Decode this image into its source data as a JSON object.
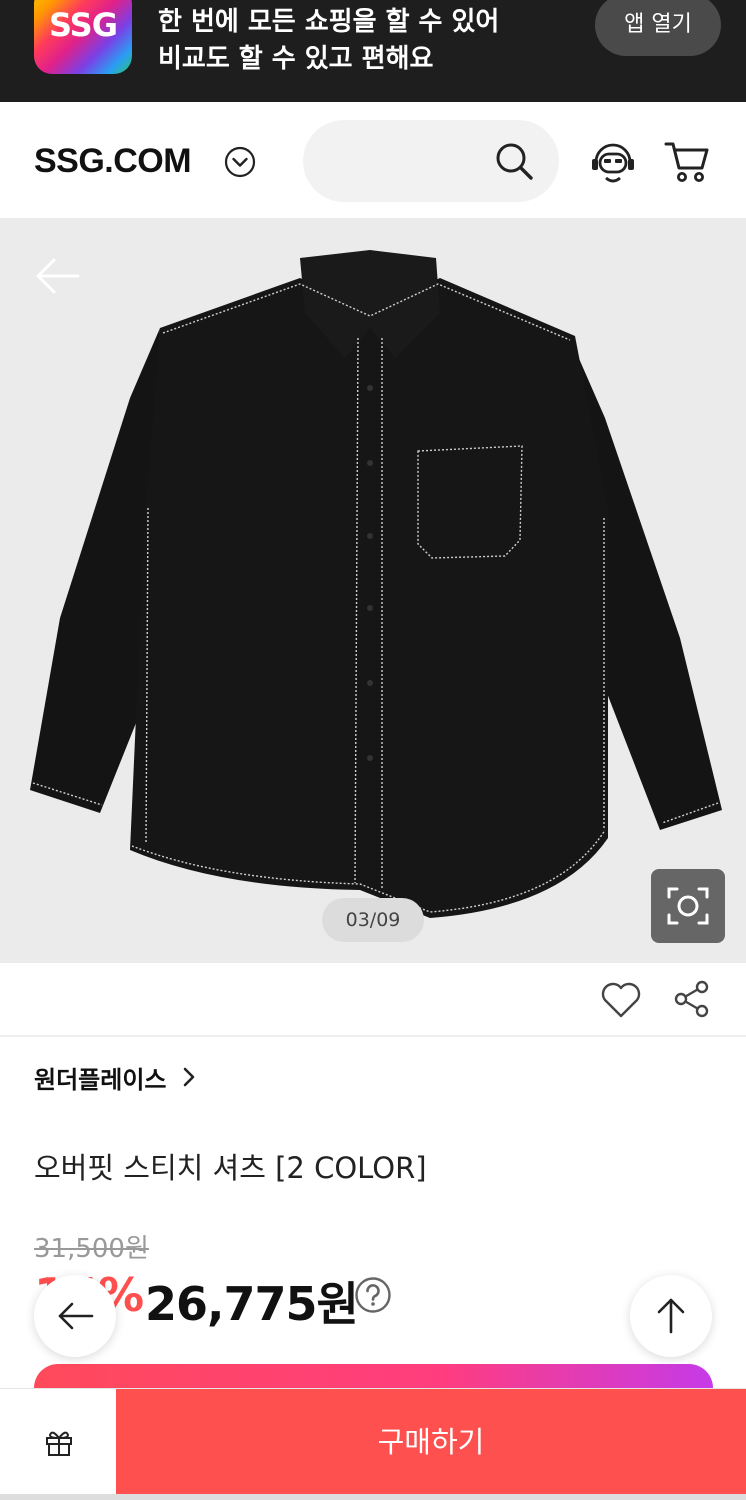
{
  "promo": {
    "logo_text": "SSG",
    "line1": "한 번에 모든 쇼핑을 할 수 있어",
    "line2": "비교도 할 수 있고 편해요",
    "open_app_label": "앱 열기"
  },
  "header": {
    "brand": "SSG.COM",
    "icons": [
      "chevron-down-icon",
      "search-icon",
      "customer-service-icon",
      "cart-icon"
    ]
  },
  "gallery": {
    "counter": "03/09"
  },
  "product": {
    "store": "원더플레이스",
    "title": "오버핏 스티치 셔츠 [2 COLOR]",
    "original_price": "31,500원",
    "discount": "15%",
    "price": "26,775원"
  },
  "bottom": {
    "buy_label": "구매하기"
  },
  "colors": {
    "accent": "#ff5050",
    "discount": "#ff4f4f",
    "banner_bg": "#1e1e1e"
  }
}
